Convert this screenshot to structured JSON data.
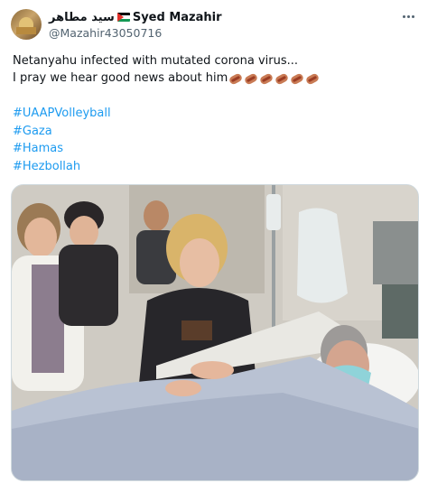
{
  "author": {
    "arabic_name": "سيد مطاهر",
    "flag_icon": "palestine-flag",
    "display_name": "Syed Mazahir",
    "handle": "@Mazahir43050716",
    "avatar_icon": "mosque-avatar"
  },
  "menu": {
    "icon": "more-horizontal-icon"
  },
  "tweet": {
    "lines": [
      "Netanyahu infected with mutated corona virus...",
      "I pray we hear good news about him"
    ],
    "emoji": {
      "name": "hot-dog-emoji",
      "count": 6
    },
    "hashtags": [
      "#UAAPVolleyball",
      "#Gaza",
      "#Hamas",
      "#Hezbollah"
    ]
  },
  "media": {
    "kind": "photo"
  },
  "colors": {
    "link": "#1d9bf0",
    "secondary_text": "#536471",
    "border": "#cfd9de"
  }
}
